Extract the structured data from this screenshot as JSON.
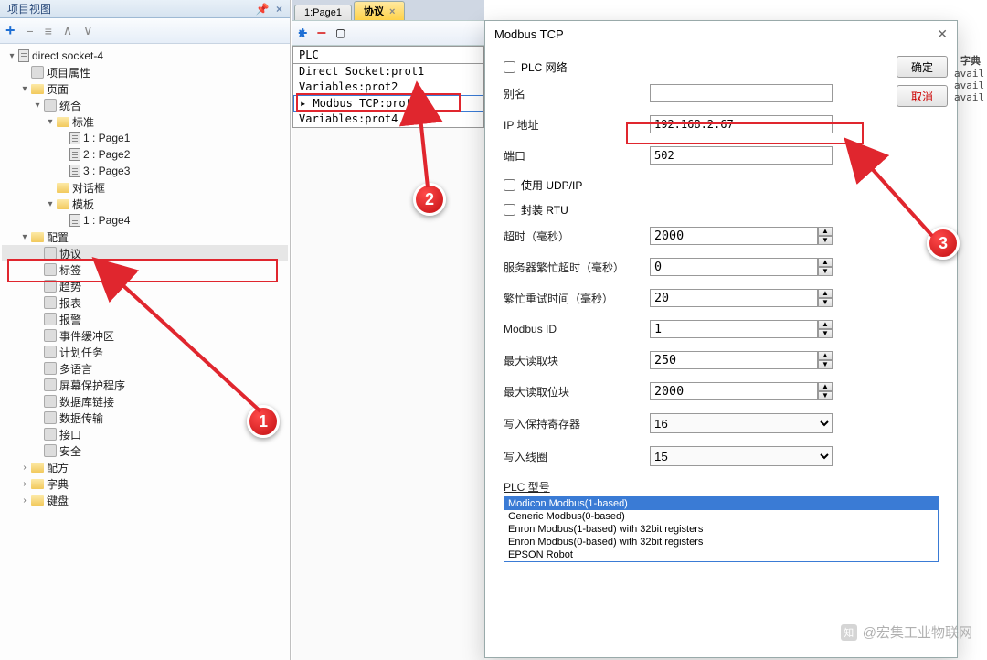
{
  "leftPanel": {
    "title": "项目视图",
    "pin": "📌",
    "close": "×",
    "toolbarIcons": [
      "+",
      "−",
      "≡",
      "∧",
      "∨"
    ],
    "tree": [
      {
        "indent": 0,
        "exp": "▾",
        "icon": "page",
        "label": "direct socket-4"
      },
      {
        "indent": 1,
        "exp": "",
        "icon": "generic",
        "label": "项目属性"
      },
      {
        "indent": 1,
        "exp": "▾",
        "icon": "folder-open",
        "label": "页面"
      },
      {
        "indent": 2,
        "exp": "▾",
        "icon": "generic",
        "label": "统合"
      },
      {
        "indent": 3,
        "exp": "▾",
        "icon": "folder-open",
        "label": "标准"
      },
      {
        "indent": 4,
        "exp": "",
        "icon": "page",
        "label": "1 : Page1"
      },
      {
        "indent": 4,
        "exp": "",
        "icon": "page",
        "label": "2 : Page2"
      },
      {
        "indent": 4,
        "exp": "",
        "icon": "page",
        "label": "3 : Page3"
      },
      {
        "indent": 3,
        "exp": "",
        "icon": "folder",
        "label": "对话框"
      },
      {
        "indent": 3,
        "exp": "▾",
        "icon": "folder-open",
        "label": "模板"
      },
      {
        "indent": 4,
        "exp": "",
        "icon": "page",
        "label": "1 : Page4"
      },
      {
        "indent": 1,
        "exp": "▾",
        "icon": "folder-open",
        "label": "配置"
      },
      {
        "indent": 2,
        "exp": "",
        "icon": "generic",
        "label": "协议",
        "highlight": true
      },
      {
        "indent": 2,
        "exp": "",
        "icon": "generic",
        "label": "标签"
      },
      {
        "indent": 2,
        "exp": "",
        "icon": "generic",
        "label": "趋势"
      },
      {
        "indent": 2,
        "exp": "",
        "icon": "generic",
        "label": "报表"
      },
      {
        "indent": 2,
        "exp": "",
        "icon": "generic",
        "label": "报警"
      },
      {
        "indent": 2,
        "exp": "",
        "icon": "generic",
        "label": "事件缓冲区"
      },
      {
        "indent": 2,
        "exp": "",
        "icon": "generic",
        "label": "计划任务"
      },
      {
        "indent": 2,
        "exp": "",
        "icon": "generic",
        "label": "多语言"
      },
      {
        "indent": 2,
        "exp": "",
        "icon": "generic",
        "label": "屏幕保护程序"
      },
      {
        "indent": 2,
        "exp": "",
        "icon": "generic",
        "label": "数据库链接"
      },
      {
        "indent": 2,
        "exp": "",
        "icon": "generic",
        "label": "数据传输"
      },
      {
        "indent": 2,
        "exp": "",
        "icon": "generic",
        "label": "接口"
      },
      {
        "indent": 2,
        "exp": "",
        "icon": "generic",
        "label": "安全"
      },
      {
        "indent": 1,
        "exp": "›",
        "icon": "folder",
        "label": "配方"
      },
      {
        "indent": 1,
        "exp": "›",
        "icon": "folder",
        "label": "字典"
      },
      {
        "indent": 1,
        "exp": "›",
        "icon": "folder",
        "label": "键盘"
      }
    ]
  },
  "midArea": {
    "tabs": [
      {
        "label": "1:Page1",
        "active": false
      },
      {
        "label": "协议",
        "active": true,
        "closable": true
      }
    ],
    "plcHeader": "PLC",
    "plcRows": [
      "Direct Socket:prot1",
      "Variables:prot2",
      "Modbus TCP:prot3",
      "Variables:prot4"
    ],
    "plcSelectedIndex": 2
  },
  "dialog": {
    "title": "Modbus TCP",
    "okLabel": "确定",
    "cancelLabel": "取消",
    "plcNetworkLabel": "PLC 网络",
    "aliasLabel": "别名",
    "aliasValue": "",
    "ipLabel": "IP 地址",
    "ipValue": "192.168.2.67",
    "portLabel": "端口",
    "portValue": "502",
    "udpLabel": "使用 UDP/IP",
    "rtuLabel": "封装 RTU",
    "timeoutLabel": "超时（毫秒）",
    "timeoutValue": "2000",
    "busyLabel": "服务器繁忙超时（毫秒）",
    "busyValue": "0",
    "retryLabel": "繁忙重试时间（毫秒）",
    "retryValue": "20",
    "modbusIdLabel": "Modbus ID",
    "modbusIdValue": "1",
    "maxReadBlockLabel": "最大读取块",
    "maxReadBlockValue": "250",
    "maxReadBitLabel": "最大读取位块",
    "maxReadBitValue": "2000",
    "writeHoldLabel": "写入保持寄存器",
    "writeHoldValue": "16",
    "writeCoilLabel": "写入线圈",
    "writeCoilValue": "15",
    "plcModelLabel": "PLC 型号",
    "plcModels": [
      "Modicon Modbus(1-based)",
      "Generic Modbus(0-based)",
      "Enron Modbus(1-based) with 32bit registers",
      "Enron Modbus(0-based) with 32bit registers",
      "EPSON Robot"
    ],
    "plcModelSelected": 0
  },
  "rightStrip": {
    "header": "字典",
    "rows": [
      "avail",
      "avail",
      "avail"
    ]
  },
  "annotations": {
    "b1": "1",
    "b2": "2",
    "b3": "3"
  },
  "watermark": {
    "logo": "知",
    "text": "@宏集工业物联网"
  }
}
